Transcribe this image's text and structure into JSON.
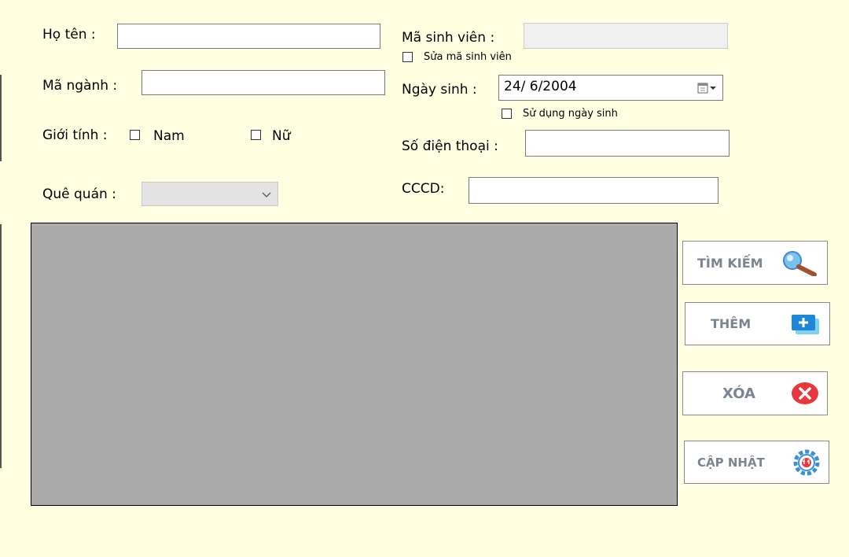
{
  "form": {
    "ho_ten_label": "Họ tên :",
    "ho_ten_value": "",
    "ma_nganh_label": "Mã ngành :",
    "ma_nganh_value": "",
    "gioi_tinh_label": "Giới tính :",
    "nam_label": "Nam",
    "nam_checked": false,
    "nu_label": "Nữ",
    "nu_checked": false,
    "que_quan_label": "Quê quán :",
    "que_quan_value": "",
    "ma_sv_label": "Mã sinh viên :",
    "ma_sv_value": "",
    "sua_ma_sv_label": "Sửa mã sinh viên",
    "sua_ma_sv_checked": false,
    "ngay_sinh_label": "Ngày sinh :",
    "ngay_sinh_value": "24/  6/2004",
    "su_dung_ngay_sinh_label": "Sử dụng ngày sinh",
    "su_dung_ngay_sinh_checked": false,
    "sdt_label": "Số điện thoại :",
    "sdt_value": "",
    "cccd_label": "CCCD:",
    "cccd_value": ""
  },
  "buttons": {
    "tim_kiem": "TÌM KIẾM",
    "them": "THÊM",
    "xoa": "XÓA",
    "cap_nhat": "CẬP NHẬT"
  },
  "colors": {
    "background": "#ffffe1",
    "grid_background": "#ababab",
    "button_text": "#7b8591",
    "delete_icon": "#e8383d",
    "add_icon": "#1e88d8"
  },
  "icons": [
    "magnifier-icon",
    "add-icon",
    "delete-icon",
    "update-gear-icon",
    "calendar-icon",
    "dropdown-arrow-icon"
  ]
}
